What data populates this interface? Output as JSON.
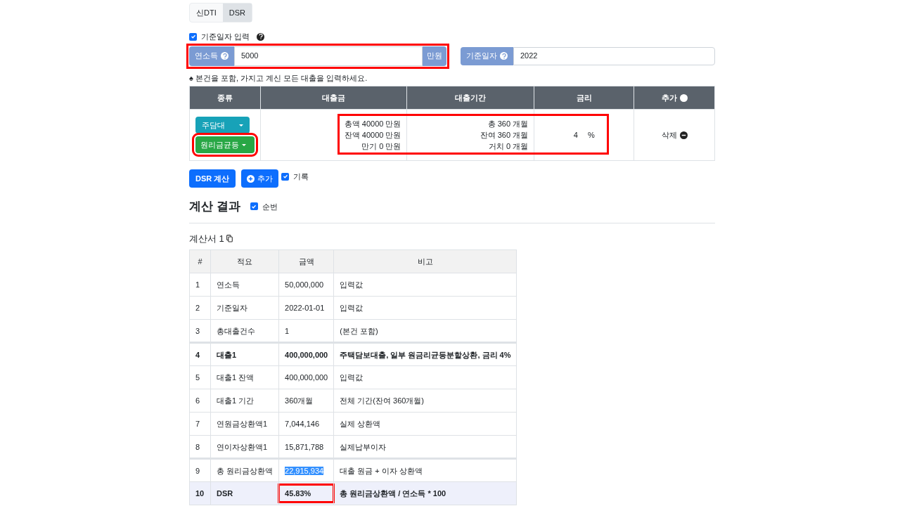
{
  "tabs": [
    {
      "label": "신DTI",
      "selected": false
    },
    {
      "label": "DSR",
      "selected": true
    }
  ],
  "date_toggle": {
    "label": "기준일자 입력",
    "checked": true
  },
  "income": {
    "label": "연소득",
    "value": "5000",
    "unit": "만원",
    "highlighted": true
  },
  "base_date": {
    "label": "기준일자",
    "value": "2022"
  },
  "notice": "♠ 본건을 포함, 가지고 계신 모든 대출을 입력하세요.",
  "loan_table": {
    "columns": [
      "종류",
      "대출금",
      "대출기간",
      "금리",
      "추가"
    ],
    "rows": [
      {
        "type_button": "주담대",
        "repay_button": "원리금균등",
        "repay_highlighted": true,
        "amount_lines": [
          "총액 40000 만원",
          "잔액 40000 만원",
          "만기 0 만원"
        ],
        "period_lines": [
          "총 360 개월",
          "잔여 360 개월",
          "거치 0 개월"
        ],
        "rate": "4",
        "rate_unit": "%",
        "details_highlighted": true,
        "delete": "삭제"
      }
    ]
  },
  "actions": {
    "calc": "DSR 계산",
    "add": "추가",
    "record": {
      "label": "기록",
      "checked": true
    }
  },
  "result": {
    "title": "계산 결과",
    "numbering": {
      "label": "순번",
      "checked": true
    }
  },
  "sheet": {
    "title": "계산서 1",
    "columns": [
      "#",
      "적요",
      "금액",
      "비고"
    ],
    "rows": [
      {
        "kind": "normal",
        "group_start": false,
        "amount_selected": false,
        "amount_highlighted": false,
        "cells": [
          "1",
          "연소득",
          "50,000,000",
          "입력값"
        ]
      },
      {
        "kind": "normal",
        "group_start": false,
        "amount_selected": false,
        "amount_highlighted": false,
        "cells": [
          "2",
          "기준일자",
          "2022-01-01",
          "입력값"
        ]
      },
      {
        "kind": "normal",
        "group_start": false,
        "amount_selected": false,
        "amount_highlighted": false,
        "cells": [
          "3",
          "총대출건수",
          "1",
          "(본건 포함)"
        ]
      },
      {
        "kind": "bold",
        "group_start": true,
        "amount_selected": false,
        "amount_highlighted": false,
        "cells": [
          "4",
          "대출1",
          "400,000,000",
          "주택담보대출, 일부 원금리균등분할상환, 금리 4%"
        ]
      },
      {
        "kind": "normal",
        "group_start": false,
        "amount_selected": false,
        "amount_highlighted": false,
        "cells": [
          "5",
          "대출1 잔액",
          "400,000,000",
          "입력값"
        ]
      },
      {
        "kind": "normal",
        "group_start": false,
        "amount_selected": false,
        "amount_highlighted": false,
        "cells": [
          "6",
          "대출1 기간",
          "360개월",
          "전체 기간(잔여 360개월)"
        ]
      },
      {
        "kind": "normal",
        "group_start": false,
        "amount_selected": false,
        "amount_highlighted": false,
        "cells": [
          "7",
          "연원금상환액1",
          "7,044,146",
          "실제 상환액"
        ]
      },
      {
        "kind": "normal",
        "group_start": false,
        "amount_selected": false,
        "amount_highlighted": false,
        "cells": [
          "8",
          "연이자상환액1",
          "15,871,788",
          "실제납부이자"
        ]
      },
      {
        "kind": "normal",
        "group_start": true,
        "amount_selected": true,
        "amount_highlighted": false,
        "cells": [
          "9",
          "총 원리금상환액",
          "22,915,934",
          "대출 원금 + 이자 상환액"
        ]
      },
      {
        "kind": "total",
        "group_start": false,
        "amount_selected": false,
        "amount_highlighted": true,
        "cells": [
          "10",
          "DSR",
          "45.83%",
          "총 원리금상환액 / 연소득 * 100"
        ]
      }
    ]
  }
}
